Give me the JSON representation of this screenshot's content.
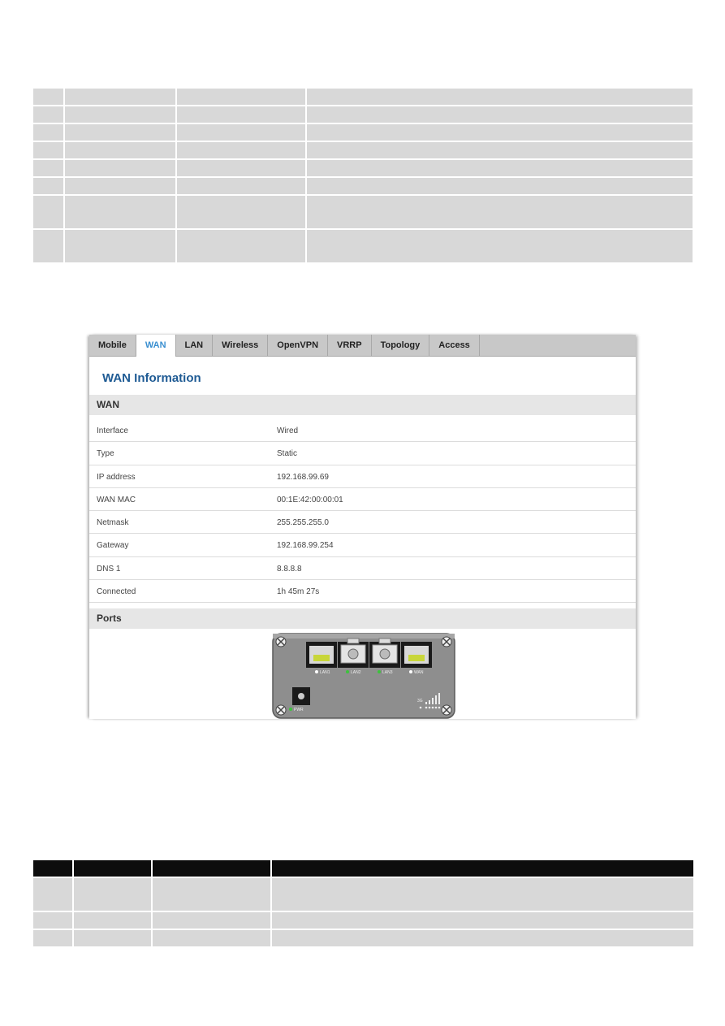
{
  "top_table": {
    "rows": 8
  },
  "tabs": [
    {
      "label": "Mobile",
      "active": false
    },
    {
      "label": "WAN",
      "active": true
    },
    {
      "label": "LAN",
      "active": false
    },
    {
      "label": "Wireless",
      "active": false
    },
    {
      "label": "OpenVPN",
      "active": false
    },
    {
      "label": "VRRP",
      "active": false
    },
    {
      "label": "Topology",
      "active": false
    },
    {
      "label": "Access",
      "active": false
    }
  ],
  "page_title": "WAN Information",
  "wan_section": {
    "title": "WAN",
    "rows": [
      {
        "label": "Interface",
        "value": "Wired"
      },
      {
        "label": "Type",
        "value": "Static"
      },
      {
        "label": "IP address",
        "value": "192.168.99.69"
      },
      {
        "label": "WAN MAC",
        "value": "00:1E:42:00:00:01"
      },
      {
        "label": "Netmask",
        "value": "255.255.255.0"
      },
      {
        "label": "Gateway",
        "value": "192.168.99.254"
      },
      {
        "label": "DNS 1",
        "value": "8.8.8.8"
      },
      {
        "label": "Connected",
        "value": "1h 45m 27s"
      }
    ]
  },
  "ports_section": {
    "title": "Ports",
    "ports": [
      {
        "label": "LAN1",
        "status": "off"
      },
      {
        "label": "LAN2",
        "status": "on"
      },
      {
        "label": "LAN3",
        "status": "on"
      },
      {
        "label": "WAN",
        "status": "off"
      }
    ],
    "power_label": "PWR",
    "colors": {
      "led_on": "#3cc33c",
      "led_off": "#ffffff",
      "body": "#8a8a8a"
    }
  }
}
